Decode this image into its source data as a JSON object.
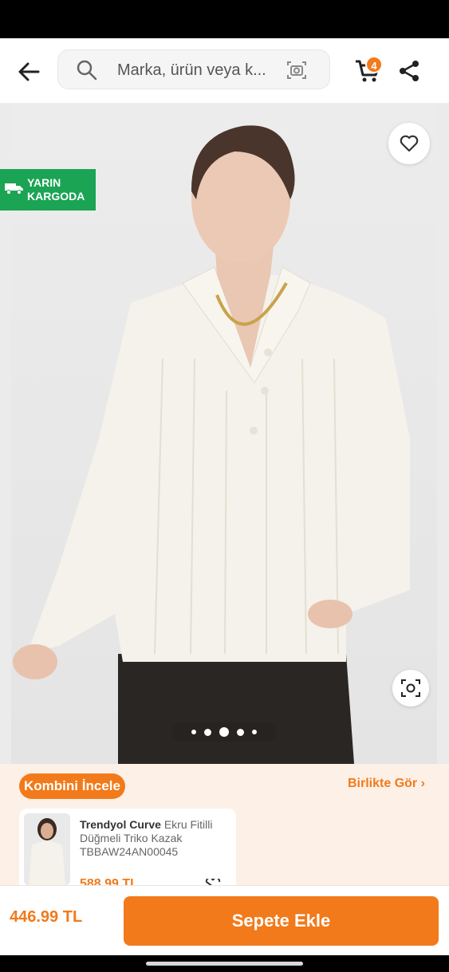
{
  "colors": {
    "accent": "#f27a1a",
    "shipping_badge": "#1aa454",
    "combo_bg": "#fdf0e6"
  },
  "header": {
    "back_icon": "arrow-left-icon",
    "search_placeholder": "Marka, ürün veya k...",
    "search_icon": "search-icon",
    "camera_icon": "camera-search-icon",
    "cart_icon": "cart-icon",
    "cart_count": "4",
    "share_icon": "share-icon"
  },
  "gallery": {
    "shipping_badge_line1": "YARIN",
    "shipping_badge_line2": "KARGODA",
    "favorite_icon": "heart-icon",
    "visual_search_icon": "lens-icon",
    "page_count": 5,
    "active_page": 3
  },
  "combo": {
    "title": "Kombini İncele",
    "link": "Birlikte Gör",
    "product": {
      "brand": "Trendyol Curve",
      "name": "Ekru Fitilli Düğmeli Triko Kazak",
      "code": "TBBAW24AN00045",
      "price": "588,99 TL"
    }
  },
  "bottom": {
    "price": "446.99 TL",
    "add_to_cart_label": "Sepete Ekle"
  }
}
